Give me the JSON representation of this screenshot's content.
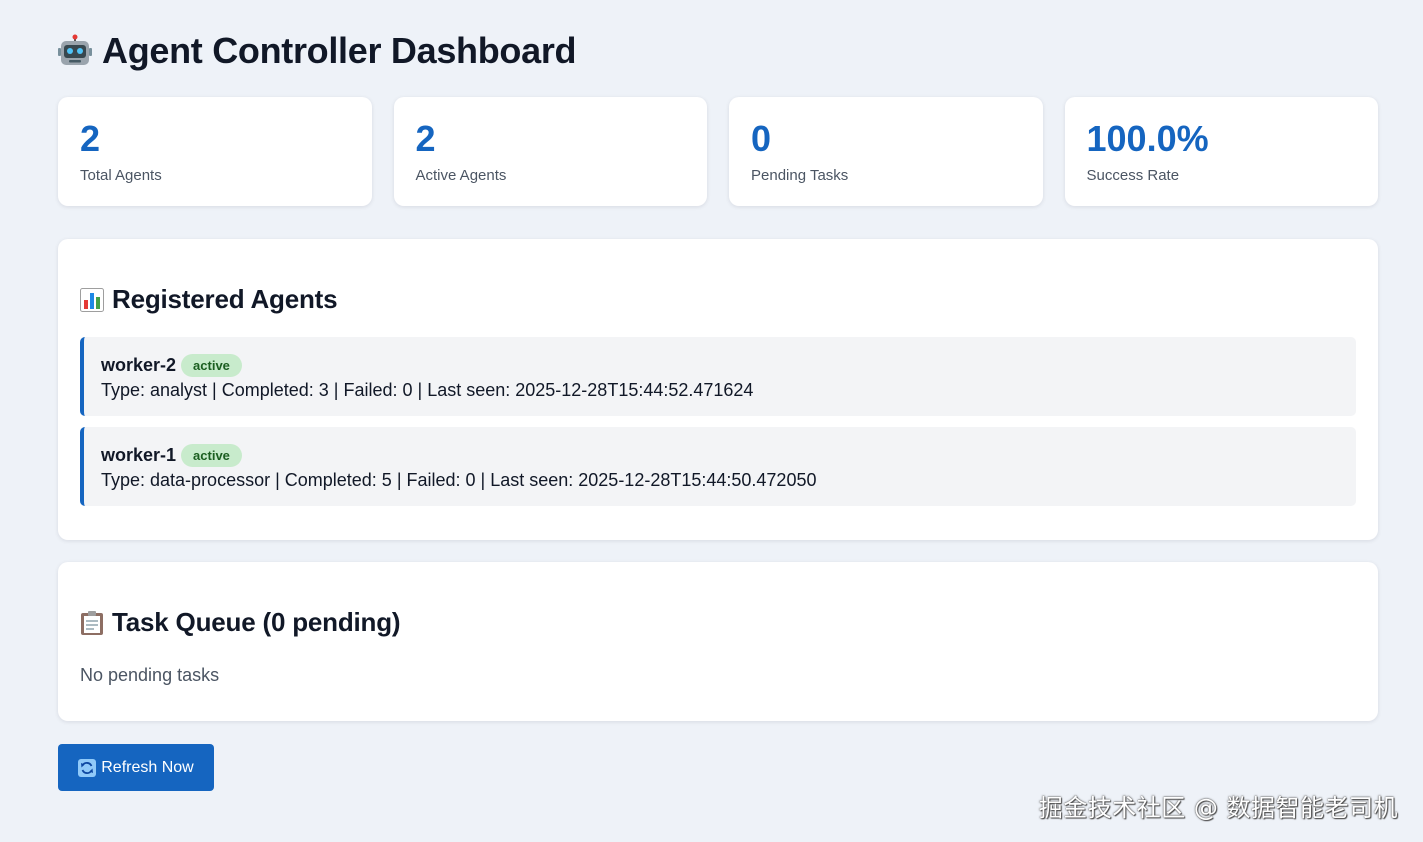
{
  "header": {
    "title": "Agent Controller Dashboard",
    "icon": "robot-icon"
  },
  "stats": [
    {
      "value": "2",
      "label": "Total Agents"
    },
    {
      "value": "2",
      "label": "Active Agents"
    },
    {
      "value": "0",
      "label": "Pending Tasks"
    },
    {
      "value": "100.0%",
      "label": "Success Rate"
    }
  ],
  "agents_panel": {
    "title": "Registered Agents",
    "icon": "bar-chart-icon",
    "agents": [
      {
        "name": "worker-2",
        "status": "active",
        "details": "Type: analyst | Completed: 3 | Failed: 0 | Last seen: 2025-12-28T15:44:52.471624"
      },
      {
        "name": "worker-1",
        "status": "active",
        "details": "Type: data-processor | Completed: 5 | Failed: 0 | Last seen: 2025-12-28T15:44:50.472050"
      }
    ]
  },
  "queue_panel": {
    "title": "Task Queue (0 pending)",
    "icon": "clipboard-icon",
    "empty_text": "No pending tasks"
  },
  "actions": {
    "refresh_label": "Refresh Now",
    "refresh_icon": "refresh-icon"
  },
  "watermark": "掘金技术社区 @ 数据智能老司机",
  "colors": {
    "accent": "#1565c0",
    "background": "#eef2f8",
    "badge_bg": "#c8ebcc",
    "badge_text": "#1b5e20"
  }
}
